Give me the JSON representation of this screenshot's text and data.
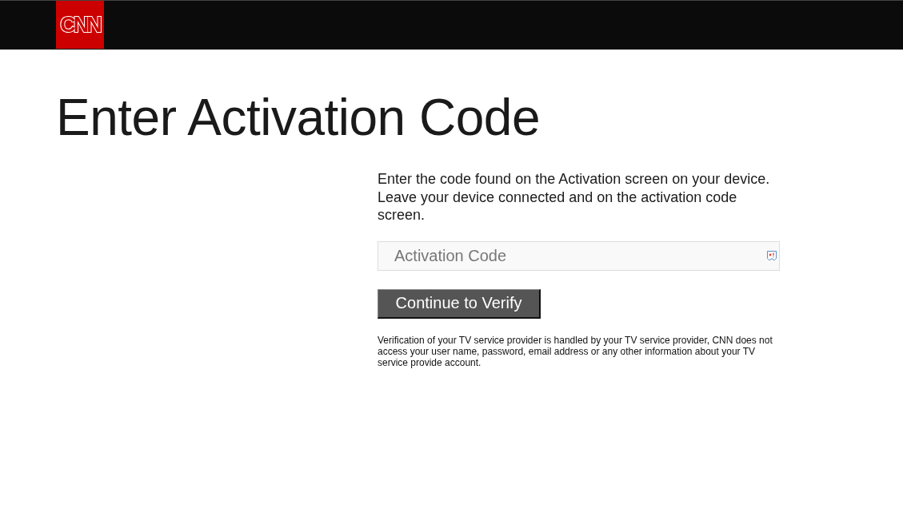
{
  "header": {
    "logo": "CNN"
  },
  "title": "Enter Activation Code",
  "instructions": "Enter the code found on the Activation screen on your device. Leave your device connected and on the activation code screen.",
  "code_field": {
    "placeholder": "Activation Code"
  },
  "submit_button": "Continue to Verify",
  "disclaimer": "Verification of your TV service provider is handled by your TV service provider, CNN does not access your user name, password, email address or any other information about your TV service provide account."
}
